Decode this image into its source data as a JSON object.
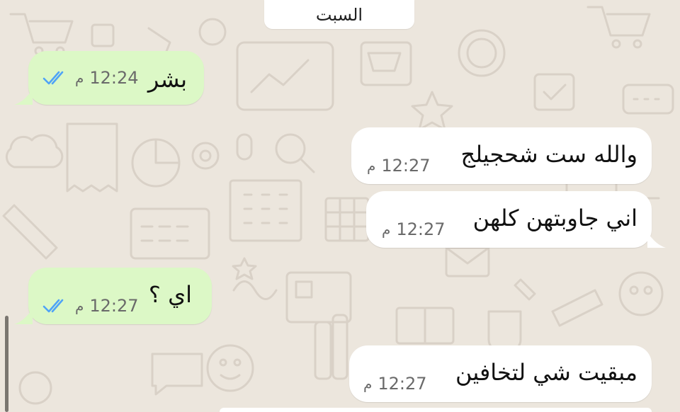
{
  "date_separator": "السبت",
  "messages": [
    {
      "direction": "sent",
      "text": "بشر",
      "time": "12:24",
      "ampm": "م",
      "status_icon": "double-check-read-icon"
    },
    {
      "direction": "received",
      "text": "والله ست شحجيلج",
      "time": "12:27",
      "ampm": "م"
    },
    {
      "direction": "received",
      "text": "اني جاوبتهن كلهن",
      "time": "12:27",
      "ampm": "م"
    },
    {
      "direction": "sent",
      "text": "اي ؟",
      "time": "12:27",
      "ampm": "م",
      "status_icon": "double-check-read-icon"
    },
    {
      "direction": "received",
      "text": "مبقيت شي لتخافين",
      "time": "12:27",
      "ampm": "م"
    }
  ],
  "colors": {
    "background": "#ece6dd",
    "sent_bubble": "#dcf8c6",
    "received_bubble": "#ffffff",
    "read_ticks": "#4fa3f7"
  }
}
